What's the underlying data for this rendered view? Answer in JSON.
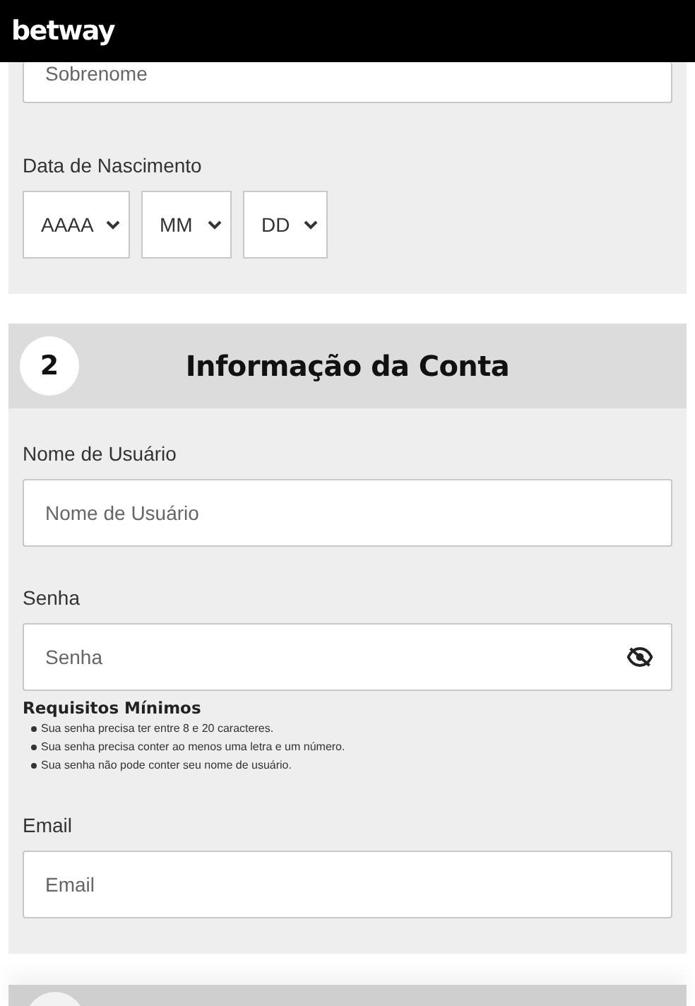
{
  "header": {
    "logo": "betway"
  },
  "personal": {
    "surname_field": {
      "placeholder": "Sobrenome"
    },
    "birth_date": {
      "label": "Data de Nascimento",
      "selects": [
        {
          "value": "AAAA"
        },
        {
          "value": "MM"
        },
        {
          "value": "DD"
        }
      ]
    }
  },
  "account": {
    "step": "2",
    "title": "Informação da Conta",
    "username": {
      "label": "Nome de Usuário",
      "placeholder": "Nome de Usuário"
    },
    "password": {
      "label": "Senha",
      "placeholder": "Senha",
      "visible": false
    },
    "requirements": {
      "title": "Requisitos Mínimos",
      "items": [
        "Sua senha precisa ter entre 8 e 20 caracteres.",
        "Sua senha precisa conter ao menos uma letra e um número.",
        "Sua senha não pode conter seu nome de usuário."
      ]
    },
    "email": {
      "label": "Email",
      "placeholder": "Email"
    }
  }
}
